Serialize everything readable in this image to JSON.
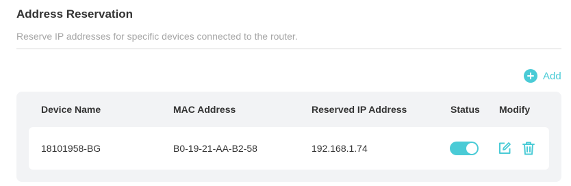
{
  "section": {
    "title": "Address Reservation",
    "subtitle": "Reserve IP addresses for specific devices connected to the router."
  },
  "toolbar": {
    "add_label": "Add",
    "add_icon": "plus-circle-icon"
  },
  "table": {
    "columns": [
      "Device Name",
      "MAC Address",
      "Reserved IP Address",
      "Status",
      "Modify"
    ],
    "rows": [
      {
        "device_name": "18101958-BG",
        "mac": "B0-19-21-AA-B2-58",
        "ip": "192.168.1.74",
        "status_enabled": true,
        "edit_icon": "edit-icon",
        "delete_icon": "trash-icon"
      }
    ]
  },
  "colors": {
    "accent": "#4acbd6",
    "title_text": "#333333",
    "muted_text": "#a6a6a6",
    "table_bg": "#f2f3f5"
  }
}
